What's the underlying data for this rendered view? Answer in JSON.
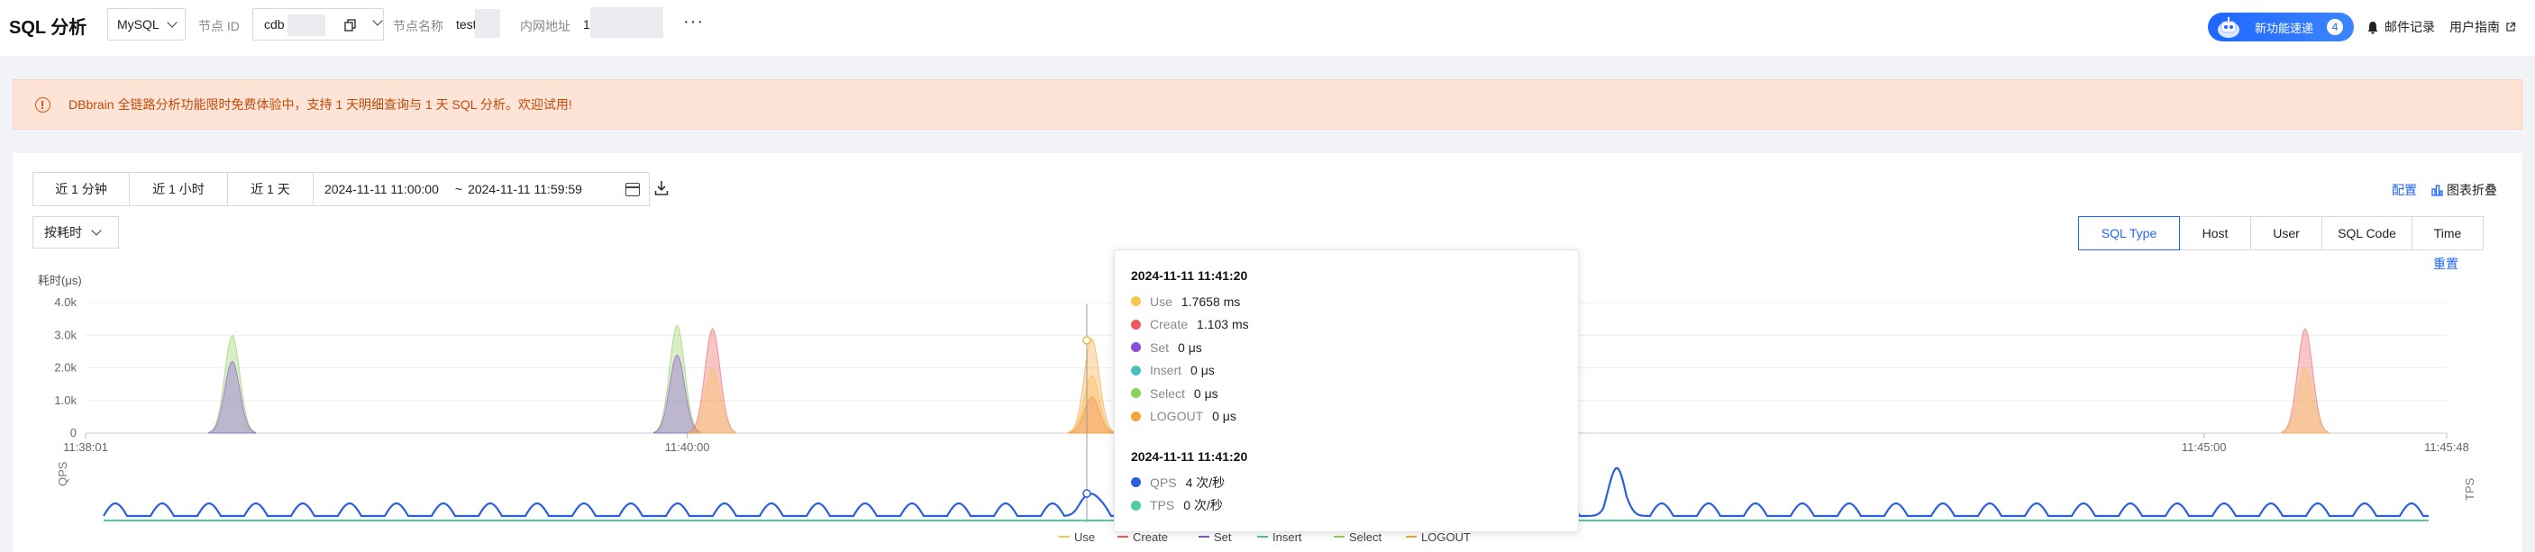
{
  "header": {
    "title": "SQL 分析",
    "db_type": "MySQL",
    "node_id_label": "节点 ID",
    "node_id_value": "cdb",
    "node_name_label": "节点名称",
    "node_name_value": "test",
    "private_ip_label": "内网地址",
    "private_ip_value": "1",
    "more_label": "···",
    "promo_label": "新功能速递",
    "promo_count": "4",
    "mail_label": "邮件记录",
    "guide_label": "用户指南"
  },
  "notice": {
    "text": "DBbrain 全链路分析功能限时免费体验中，支持 1 天明细查询与 1 天 SQL 分析。欢迎试用!"
  },
  "toolbar": {
    "quick_ranges": [
      "近 1 分钟",
      "近 1 小时",
      "近 1 天"
    ],
    "range_start": "2024-11-11 11:00:00",
    "range_sep": "~",
    "range_end": "2024-11-11 11:59:59",
    "sort_label": "按耗时",
    "config_label": "配置",
    "collapse_label": "图表折叠",
    "reset_label": "重置",
    "tabs": [
      "SQL Type",
      "Host",
      "User",
      "SQL Code",
      "Time"
    ],
    "active_tab": "SQL Type"
  },
  "colors": {
    "accent": "#1f66ff",
    "use": "#f5c74f",
    "create": "#ec5b5b",
    "set": "#8a4fd8",
    "insert": "#4bbec0",
    "select": "#8ed15b",
    "logout": "#f5a23c",
    "qps": "#2b5fe0",
    "tps": "#4fcf9a"
  },
  "chart_data": [
    {
      "type": "area",
      "ylabel": "耗时(μs)",
      "y_ticks": [
        "0",
        "1.0k",
        "2.0k",
        "3.0k",
        "4.0k"
      ],
      "ylim": [
        0,
        4000
      ],
      "x_ticks": [
        "11:38:01",
        "11:40:00",
        "11:45:00",
        "11:45:48"
      ],
      "series": [
        {
          "name": "Use",
          "points": [
            [
              "11:40:05",
              2000
            ],
            [
              "11:41:20",
              1766
            ],
            [
              "11:45:20",
              2000
            ]
          ]
        },
        {
          "name": "Create",
          "points": [
            [
              "11:40:05",
              3200
            ],
            [
              "11:41:20",
              1103
            ],
            [
              "11:45:20",
              3200
            ]
          ]
        },
        {
          "name": "Set",
          "points": [
            [
              "11:38:30",
              2200
            ],
            [
              "11:39:58",
              2400
            ]
          ]
        },
        {
          "name": "Insert",
          "points": []
        },
        {
          "name": "Select",
          "points": [
            [
              "11:38:30",
              3000
            ],
            [
              "11:39:58",
              3300
            ]
          ]
        },
        {
          "name": "LOGOUT",
          "points": [
            [
              "11:41:20",
              2900
            ]
          ]
        }
      ],
      "legend": [
        "Use",
        "Create",
        "Set",
        "Insert",
        "Select",
        "LOGOUT"
      ],
      "legend_position": "bottom",
      "grid": true
    },
    {
      "type": "line",
      "ylabel_left": "QPS",
      "ylabel_right": "TPS",
      "series": [
        {
          "name": "QPS",
          "note": "periodic small waves with spikes near 11:41:20 and 11:43:00"
        },
        {
          "name": "TPS",
          "values_flat": 0
        }
      ]
    }
  ],
  "tooltip": {
    "sections": [
      {
        "time": "2024-11-11 11:41:20",
        "rows": [
          {
            "name": "Use",
            "value": "1.7658 ms",
            "color": "#f5c74f"
          },
          {
            "name": "Create",
            "value": "1.103 ms",
            "color": "#ec5b5b"
          },
          {
            "name": "Set",
            "value": "0 μs",
            "color": "#8a4fd8"
          },
          {
            "name": "Insert",
            "value": "0 μs",
            "color": "#4bbec0"
          },
          {
            "name": "Select",
            "value": "0 μs",
            "color": "#8ed15b"
          },
          {
            "name": "LOGOUT",
            "value": "0 μs",
            "color": "#f5a23c"
          }
        ]
      },
      {
        "time": "2024-11-11 11:41:20",
        "rows": [
          {
            "name": "QPS",
            "value": "4 次/秒",
            "color": "#2b5fe0"
          },
          {
            "name": "TPS",
            "value": "0 次/秒",
            "color": "#4fcf9a"
          }
        ]
      }
    ]
  }
}
